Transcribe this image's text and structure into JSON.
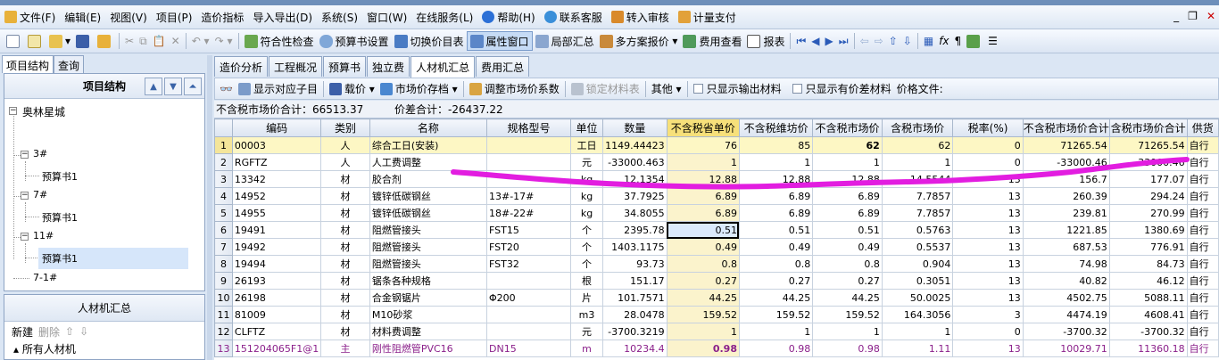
{
  "menu": {
    "items": [
      "文件(F)",
      "编辑(E)",
      "视图(V)",
      "项目(P)",
      "造价指标",
      "导入导出(D)",
      "系统(S)",
      "窗口(W)",
      "在线服务(L)",
      "帮助(H)",
      "联系客服",
      "转入审核",
      "计量支付"
    ]
  },
  "toolbar": {
    "compliance": "符合性检查",
    "budget_settings": "预算书设置",
    "switch_price_table": "切换价目表",
    "property_window": "属性窗口",
    "local_summary": "局部汇总",
    "multi_quote": "多方案报价",
    "fee_view": "费用查看",
    "report": "报表"
  },
  "left": {
    "tabs": [
      "项目结构",
      "查询"
    ],
    "title": "项目结构",
    "tree": [
      {
        "label": "奥林星城",
        "level": 0
      },
      {
        "label": "3#",
        "level": 1
      },
      {
        "label": "预算书1",
        "level": 2
      },
      {
        "label": "7#",
        "level": 1
      },
      {
        "label": "预算书1",
        "level": 2
      },
      {
        "label": "11#",
        "level": 1
      },
      {
        "label": "预算书1",
        "level": 2
      },
      {
        "label": "7-1#",
        "level": 1
      }
    ],
    "bottom_title": "人材机汇总",
    "new_label": "新建",
    "delete_label": "删除",
    "all_item": "所有人材机"
  },
  "tabs": [
    "造价分析",
    "工程概况",
    "预算书",
    "独立费",
    "人材机汇总",
    "费用汇总"
  ],
  "subtoolbar": {
    "show_sub": "显示对应子目",
    "load_price": "载价",
    "market_archive": "市场价存档",
    "adjust_coef": "调整市场价系数",
    "lock_material": "锁定材料表",
    "other": "其他",
    "only_output": "只显示输出材料",
    "only_diff": "只显示有价差材料",
    "price_file": "价格文件:"
  },
  "summary": {
    "market_total": "不含税市场价合计：66513.37",
    "diff_total": "价差合计：-26437.22"
  },
  "table": {
    "headers": [
      "编码",
      "类别",
      "名称",
      "规格型号",
      "单位",
      "数量",
      "不含税省单价",
      "不含税维坊价",
      "不含税市场价",
      "含税市场价",
      "税率(%)",
      "不含税市场价合计",
      "含税市场价合计",
      "供货"
    ],
    "rows": [
      [
        "1",
        "00003",
        "人",
        "综合工日(安装)",
        "",
        "工日",
        "1149.44423",
        "76",
        "85",
        "62",
        "62",
        "0",
        "71265.54",
        "71265.54",
        "自行"
      ],
      [
        "2",
        "RGFTZ",
        "人",
        "人工费调整",
        "",
        "元",
        "-33000.463",
        "1",
        "1",
        "1",
        "1",
        "0",
        "-33000.46",
        "-33000.46",
        "自行"
      ],
      [
        "3",
        "13342",
        "材",
        "胶合剂",
        "",
        "kg",
        "12.1354",
        "12.88",
        "12.88",
        "12.88",
        "14.5544",
        "13",
        "156.7",
        "177.07",
        "自行"
      ],
      [
        "4",
        "14952",
        "材",
        "镀锌低碳钢丝",
        "13#-17#",
        "kg",
        "37.7925",
        "6.89",
        "6.89",
        "6.89",
        "7.7857",
        "13",
        "260.39",
        "294.24",
        "自行"
      ],
      [
        "5",
        "14955",
        "材",
        "镀锌低碳钢丝",
        "18#-22#",
        "kg",
        "34.8055",
        "6.89",
        "6.89",
        "6.89",
        "7.7857",
        "13",
        "239.81",
        "270.99",
        "自行"
      ],
      [
        "6",
        "19491",
        "材",
        "阻燃管接头",
        "FST15",
        "个",
        "2395.78",
        "0.51",
        "0.51",
        "0.51",
        "0.5763",
        "13",
        "1221.85",
        "1380.69",
        "自行"
      ],
      [
        "7",
        "19492",
        "材",
        "阻燃管接头",
        "FST20",
        "个",
        "1403.1175",
        "0.49",
        "0.49",
        "0.49",
        "0.5537",
        "13",
        "687.53",
        "776.91",
        "自行"
      ],
      [
        "8",
        "19494",
        "材",
        "阻燃管接头",
        "FST32",
        "个",
        "93.73",
        "0.8",
        "0.8",
        "0.8",
        "0.904",
        "13",
        "74.98",
        "84.73",
        "自行"
      ],
      [
        "9",
        "26193",
        "材",
        "锯条各种规格",
        "",
        "根",
        "151.17",
        "0.27",
        "0.27",
        "0.27",
        "0.3051",
        "13",
        "40.82",
        "46.12",
        "自行"
      ],
      [
        "10",
        "26198",
        "材",
        "合金钢锯片",
        "Φ200",
        "片",
        "101.7571",
        "44.25",
        "44.25",
        "44.25",
        "50.0025",
        "13",
        "4502.75",
        "5088.11",
        "自行"
      ],
      [
        "11",
        "81009",
        "材",
        "M10砂浆",
        "",
        "m3",
        "28.0478",
        "159.52",
        "159.52",
        "159.52",
        "164.3056",
        "3",
        "4474.19",
        "4608.41",
        "自行"
      ],
      [
        "12",
        "CLFTZ",
        "材",
        "材料费调整",
        "",
        "元",
        "-3700.3219",
        "1",
        "1",
        "1",
        "1",
        "0",
        "-3700.32",
        "-3700.32",
        "自行"
      ],
      [
        "13",
        "151204065F1@1",
        "主",
        "刚性阻燃管PVC16",
        "DN15",
        "m",
        "10234.4",
        "0.98",
        "0.98",
        "0.98",
        "1.11",
        "13",
        "10029.71",
        "11360.18",
        "自行"
      ]
    ]
  },
  "colors": {
    "accent": "#f7e07a",
    "annotation": "#e21de0",
    "purple_row": "#8a1f8a"
  }
}
